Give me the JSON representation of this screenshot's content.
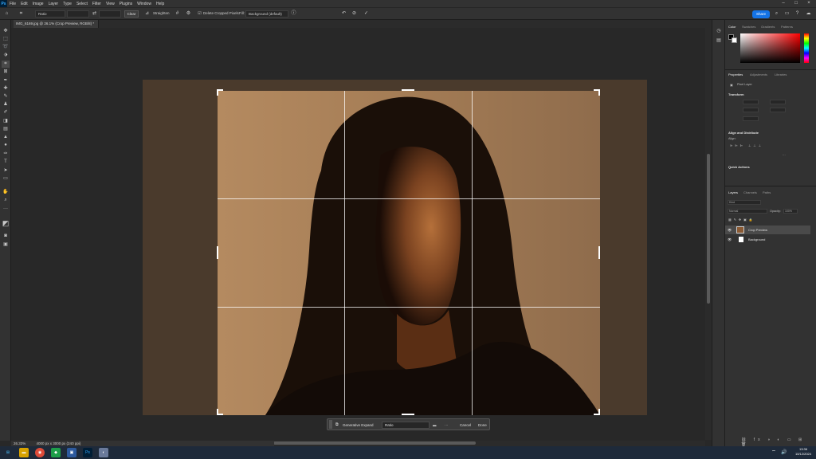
{
  "menubar": {
    "app_icon": "Ps",
    "items": [
      "File",
      "Edit",
      "Image",
      "Layer",
      "Type",
      "Select",
      "Filter",
      "View",
      "Plugins",
      "Window",
      "Help"
    ]
  },
  "options_bar": {
    "ratio_select": "Ratio",
    "clear_label": "Clear",
    "straighten_label": "Straighten",
    "delete_cropped_label": "Delete Cropped Pixels",
    "fill_label": "Fill:",
    "fill_select": "Background (default)",
    "share_label": "Share"
  },
  "document_tab": {
    "title": "IMG_6169.jpg @ 26.1% (Crop Preview, RGB/8) *"
  },
  "context_bar": {
    "generative_expand_label": "Generative Expand",
    "ratio_select": "Ratio",
    "more_label": "···",
    "cancel_label": "Cancel",
    "done_label": "Done"
  },
  "status": {
    "zoom": "26.33%",
    "dimensions": "4000 px x 3000 px (240 ppi)"
  },
  "color_panel": {
    "tabs": [
      "Color",
      "Swatches",
      "Gradients",
      "Patterns"
    ],
    "accent": "#ff0000"
  },
  "properties_panel": {
    "tabs": [
      "Properties",
      "Adjustments",
      "Libraries"
    ],
    "layer_type": "Pixel Layer",
    "transform_label": "Transform",
    "align_label": "Align and Distribute",
    "align_sub": "Align:",
    "quick_actions_label": "Quick Actions"
  },
  "layers_panel": {
    "tabs": [
      "Layers",
      "Channels",
      "Paths"
    ],
    "blend_mode": "Normal",
    "opacity_label": "Opacity:",
    "opacity_value": "100%",
    "search_placeholder": "Kind",
    "layers": [
      {
        "name": "Crop Preview",
        "selected": true
      },
      {
        "name": "Background",
        "selected": false
      }
    ]
  },
  "taskbar": {
    "time": "13:36",
    "date": "10/12/2024"
  },
  "icons": {
    "search": "search-icon",
    "undo": "undo-icon",
    "cancel": "cancel-icon",
    "commit": "checkmark-icon"
  }
}
